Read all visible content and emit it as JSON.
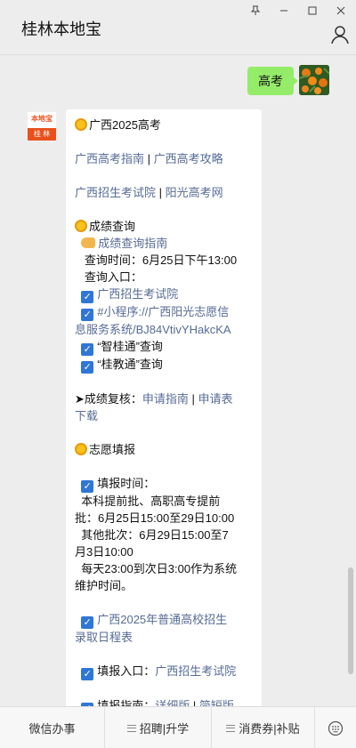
{
  "window": {
    "title": "桂林本地宝",
    "controls": {
      "pin": "pin-icon",
      "minimize": "minimize-icon",
      "maximize": "maximize-icon",
      "close": "close-icon"
    },
    "profile_icon": "person-icon"
  },
  "chat": {
    "outgoing": {
      "text": "高考"
    },
    "bot_avatar": {
      "top_text": "本地宝",
      "bottom_text": "桂 林"
    },
    "bot_message": {
      "heading": "广西2025高考",
      "link_gaokao_zhinan": "广西高考指南",
      "sep1": " | ",
      "link_gaokao_gonglue": "广西高考攻略",
      "link_zhaokao_yuan": "广西招生考试院",
      "sep2": " | ",
      "link_yangguang": "阳光高考网",
      "score_heading": "成绩查询",
      "score_guide_link": "成绩查询指南",
      "score_time": "查询时间：6月25日下午13:00",
      "score_entry": "查询入口：",
      "entry1_link": "广西招生考试院",
      "entry2_link_line1": "#小程序://广西阳光志愿信",
      "entry2_link_line2": "息服务系统/BJ84VtivYHakcKA",
      "entry3": "“智桂通”查询",
      "entry4": "“桂教通”查询",
      "recheck_label": "➤成绩复核：",
      "recheck_link1": "申请指南",
      "recheck_sep": " | ",
      "recheck_link2_part1": "申请表",
      "recheck_link2_part2": "下载",
      "volunteer_heading": "志愿填报",
      "fill_time_label": "填报时间：",
      "fill_time_l1": "本科提前批、高职高专提前",
      "fill_time_l2": "批：6月25日15:00至29日10:00",
      "fill_time_l3": "其他批次：6月29日15:00至7",
      "fill_time_l4": "月3日10:00",
      "fill_time_l5": "每天23:00到次日3:00作为系统",
      "fill_time_l6": "维护时间。",
      "schedule_link_l1": "广西2025年普通高校招生",
      "schedule_link_l2": "录取日程表",
      "fill_entry_label": "填报入口：",
      "fill_entry_link": "广西招生考试院",
      "fill_guide_label": "填报指南：",
      "fill_guide_link1": "详细版",
      "fill_guide_sep": " | ",
      "fill_guide_link2": "简短版"
    }
  },
  "menu": {
    "items": [
      {
        "label": "微信办事"
      },
      {
        "label": "招聘|升学"
      },
      {
        "label": "消费券|补贴"
      }
    ],
    "keyboard_icon": "keyboard-icon"
  },
  "colors": {
    "link": "#576b95",
    "self_bubble": "#95ec69",
    "checkbox": "#2f76d6",
    "brand": "#e8501c"
  }
}
